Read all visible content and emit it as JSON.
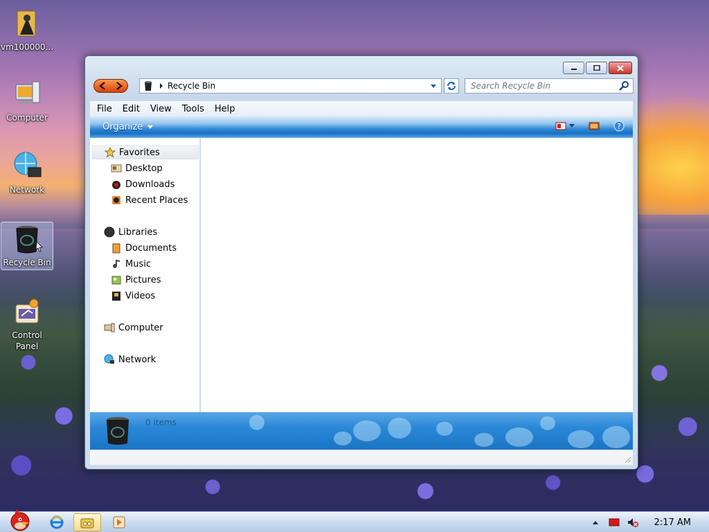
{
  "desktop": {
    "icons": [
      {
        "label": "vm100000..."
      },
      {
        "label": "Computer"
      },
      {
        "label": "Network"
      },
      {
        "label": "Recycle Bin"
      },
      {
        "label": "Control Panel"
      }
    ]
  },
  "window": {
    "address": "Recycle Bin",
    "search_placeholder": "Search Recycle Bin",
    "menu": [
      "File",
      "Edit",
      "View",
      "Tools",
      "Help"
    ],
    "toolbar": {
      "organize": "Organize"
    },
    "nav": {
      "favorites": "Favorites",
      "desktop": "Desktop",
      "downloads": "Downloads",
      "recent_places": "Recent Places",
      "libraries": "Libraries",
      "documents": "Documents",
      "music": "Music",
      "pictures": "Pictures",
      "videos": "Videos",
      "computer": "Computer",
      "network": "Network"
    },
    "details": {
      "count": "0 items"
    }
  },
  "taskbar": {
    "clock": "2:17 AM"
  },
  "colors": {
    "accent": "#2b88d8",
    "nav_arrows": "#e05a1a"
  }
}
